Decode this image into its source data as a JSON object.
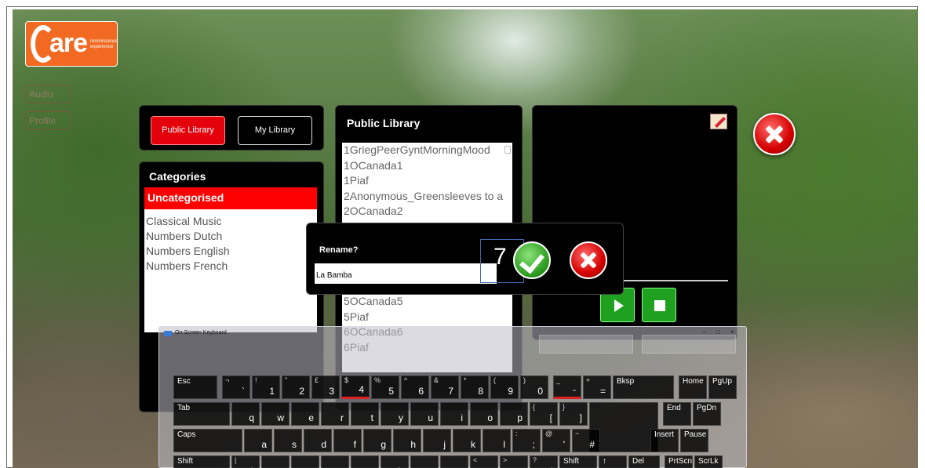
{
  "logo": {
    "word": "are",
    "tagline_1": "reminiscence",
    "tagline_2": "experience"
  },
  "left_faint_buttons": [
    "Audio",
    "Profile"
  ],
  "library_tabs": {
    "public": "Public Library",
    "mine": "My Library"
  },
  "categories": {
    "title": "Categories",
    "selected": "Uncategorised",
    "items": [
      "Classical Music",
      "Numbers Dutch",
      "Numbers English",
      "Numbers French"
    ]
  },
  "public_library": {
    "title": "Public Library",
    "tracks": [
      "1GriegPeerGyntMorningMood",
      "1OCanada1",
      "1Piaf",
      "2Anonymous_Greensleeves to a",
      "2OCanada2"
    ],
    "tracks_below": [
      "5OCanada5",
      "5Piaf",
      "6OCanada6",
      "6Piaf"
    ]
  },
  "rename_dialog": {
    "label": "Rename?",
    "value": "La Bamba",
    "step_number": "7"
  },
  "keyboard": {
    "title": "On-Screen Keyboard",
    "row1": [
      {
        "main": "Esc"
      },
      {
        "shifted": "¬",
        "main": "`"
      },
      {
        "shifted": "!",
        "main": "1"
      },
      {
        "shifted": "\"",
        "main": "2"
      },
      {
        "shifted": "£",
        "main": "3"
      },
      {
        "shifted": "$",
        "main": "4"
      },
      {
        "shifted": "%",
        "main": "5"
      },
      {
        "shifted": "^",
        "main": "6"
      },
      {
        "shifted": "&",
        "main": "7"
      },
      {
        "shifted": "*",
        "main": "8"
      },
      {
        "shifted": "(",
        "main": "9"
      },
      {
        "shifted": ")",
        "main": "0"
      },
      {
        "shifted": "_",
        "main": "-"
      },
      {
        "shifted": "+",
        "main": "="
      },
      {
        "main": "Bksp"
      },
      {
        "main": "Home"
      },
      {
        "main": "PgUp"
      }
    ],
    "row2": [
      {
        "main": "Tab"
      },
      {
        "main": "q"
      },
      {
        "main": "w"
      },
      {
        "main": "e"
      },
      {
        "main": "r"
      },
      {
        "main": "t"
      },
      {
        "main": "y"
      },
      {
        "main": "u"
      },
      {
        "main": "i"
      },
      {
        "main": "o"
      },
      {
        "main": "p"
      },
      {
        "shifted": "{",
        "main": "["
      },
      {
        "shifted": "}",
        "main": "]"
      },
      {
        "main": ""
      },
      {
        "main": "End"
      },
      {
        "main": "PgDn"
      }
    ],
    "row3": [
      {
        "main": "Caps"
      },
      {
        "main": "a"
      },
      {
        "main": "s"
      },
      {
        "main": "d"
      },
      {
        "main": "f"
      },
      {
        "main": "g"
      },
      {
        "main": "h"
      },
      {
        "main": "j"
      },
      {
        "main": "k"
      },
      {
        "main": "l"
      },
      {
        "shifted": ":",
        "main": ";"
      },
      {
        "shifted": "@",
        "main": "'"
      },
      {
        "shifted": "~",
        "main": "#"
      },
      {
        "main": "Insert"
      },
      {
        "main": "Pause"
      }
    ],
    "row4": [
      {
        "main": "Shift"
      },
      {
        "shifted": "|",
        "main": "\\"
      },
      {
        "main": "z"
      },
      {
        "main": "x"
      },
      {
        "main": "c"
      },
      {
        "main": "v"
      },
      {
        "main": "b"
      },
      {
        "main": "n"
      },
      {
        "main": "m"
      },
      {
        "shifted": "<",
        "main": ","
      },
      {
        "shifted": ">",
        "main": "."
      },
      {
        "shifted": "?",
        "main": "/"
      },
      {
        "main": "Shift"
      },
      {
        "main": "↑"
      },
      {
        "main": "Del"
      },
      {
        "main": "PrtScn"
      },
      {
        "main": "ScrLk"
      }
    ]
  }
}
